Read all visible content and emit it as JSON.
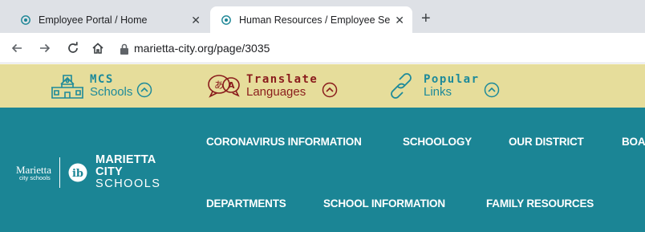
{
  "browser": {
    "tabs": [
      {
        "title": "Employee Portal / Home",
        "active": false
      },
      {
        "title": "Human Resources / Employee Se",
        "active": true
      }
    ],
    "close_glyph": "✕",
    "new_tab_glyph": "+",
    "url": "marietta-city.org/page/3035"
  },
  "utility_bar": {
    "background": "#e6dd9b",
    "items": [
      {
        "top": "MCS",
        "bottom": "Schools",
        "icon": "school-building-icon",
        "color": "#1d8a9a"
      },
      {
        "top": "Translate",
        "bottom": "Languages",
        "icon": "translate-speech-icon",
        "color": "#8a1c1c"
      },
      {
        "top": "Popular",
        "bottom": "Links",
        "icon": "link-chain-icon",
        "color": "#1d8a9a"
      }
    ]
  },
  "header": {
    "background": "#1b8595",
    "logo": {
      "wordmark": "Marietta",
      "wordmark_sub": "city schools",
      "name_line1": "MARIETTA",
      "name_line2": "CITY",
      "name_line3": "SCHOOLS"
    },
    "nav_row1": [
      "CORONAVIRUS INFORMATION",
      "SCHOOLOGY",
      "OUR DISTRICT",
      "BOA"
    ],
    "nav_row2": [
      "DEPARTMENTS",
      "SCHOOL INFORMATION",
      "FAMILY RESOURCES"
    ]
  }
}
